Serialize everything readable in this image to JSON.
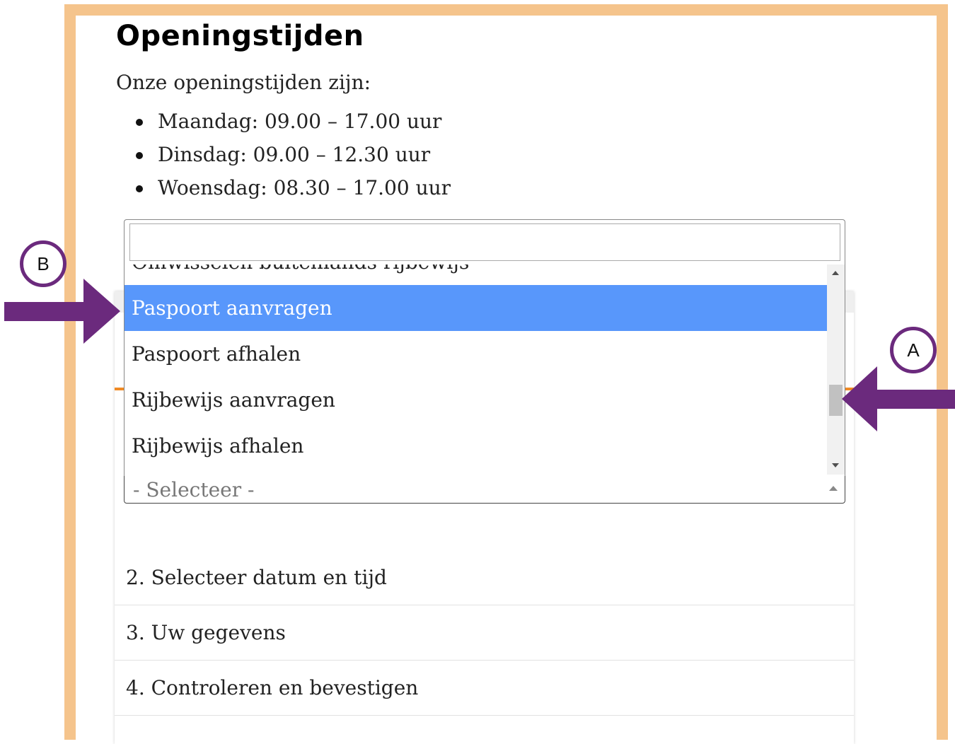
{
  "page": {
    "title": "Openingstijden",
    "intro": "Onze openingstijden zijn:",
    "hours": [
      "Maandag: 09.00 – 17.00 uur",
      "Dinsdag: 09.00 – 12.30 uur",
      "Woensdag: 08.30 – 17.00 uur"
    ]
  },
  "dropdown": {
    "search_value": "",
    "partial_option": "Omwisselen buitenlands rijbewijs",
    "options": [
      "Paspoort aanvragen",
      "Paspoort afhalen",
      "Rijbewijs aanvragen",
      "Rijbewijs afhalen"
    ],
    "highlighted_option": "Paspoort aanvragen",
    "selected_value": "- Selecteer -"
  },
  "steps": [
    "2. Selecteer datum en tijd",
    "3. Uw gegevens",
    "4. Controleren en bevestigen"
  ],
  "annotations": {
    "label_a": "A",
    "label_b": "B"
  },
  "colors": {
    "frame": "#f5c48c",
    "highlight": "#5897fb",
    "annotation": "#6b2a7d",
    "accent": "#f08a24"
  }
}
